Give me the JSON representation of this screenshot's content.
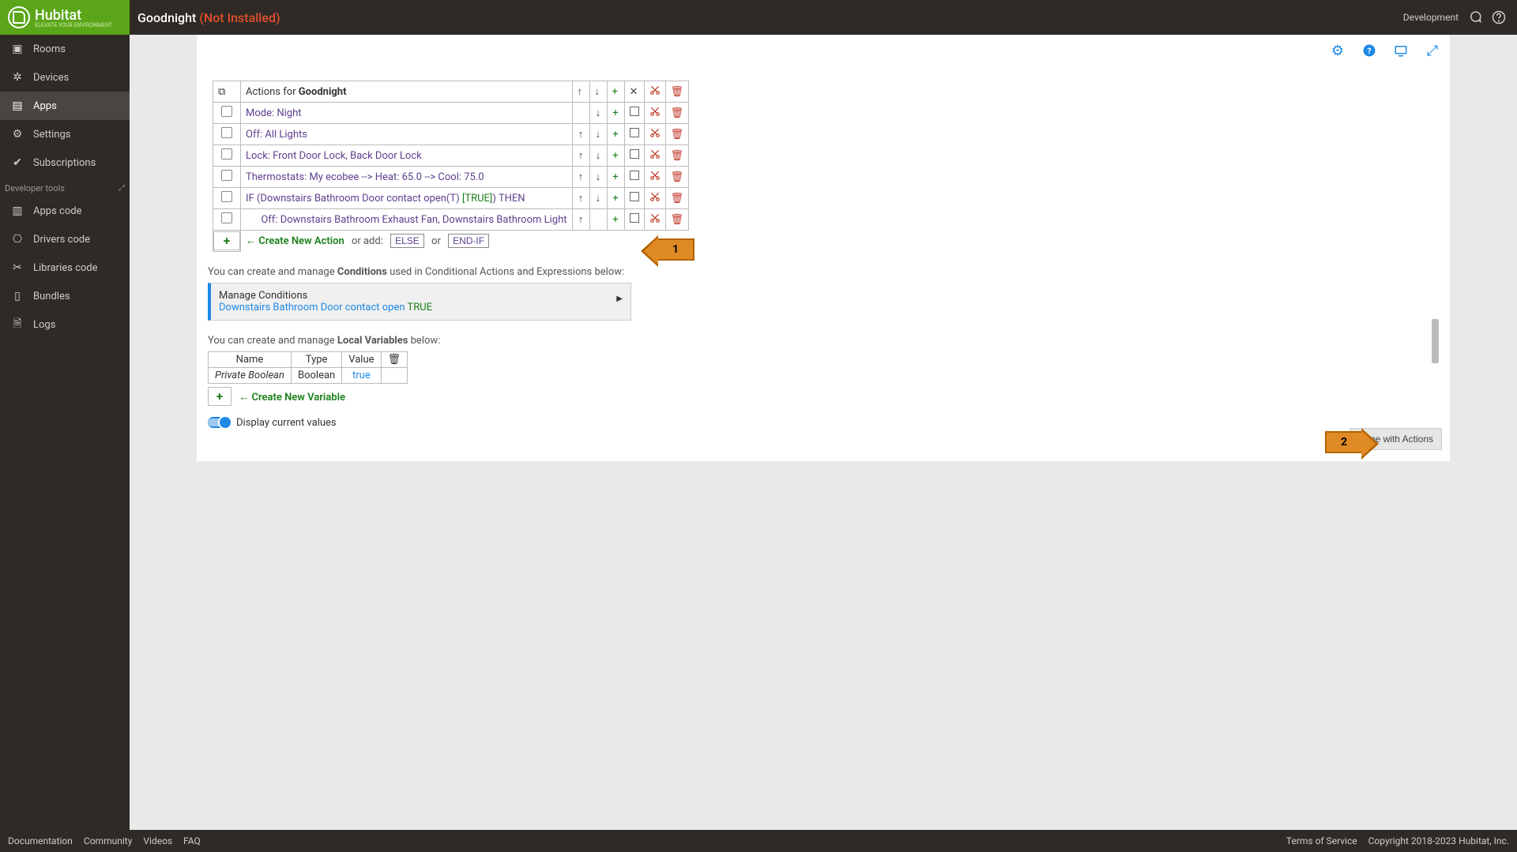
{
  "brand": {
    "name": "Hubitat",
    "tagline": "ELEVATE YOUR ENVIRONMENT"
  },
  "header": {
    "title": "Goodnight",
    "status": "(Not Installed)",
    "env": "Development"
  },
  "sidebar": {
    "main": [
      {
        "label": "Rooms",
        "icon": "▣"
      },
      {
        "label": "Devices",
        "icon": "✲"
      },
      {
        "label": "Apps",
        "icon": "▤"
      },
      {
        "label": "Settings",
        "icon": "⚙"
      },
      {
        "label": "Subscriptions",
        "icon": "✔"
      }
    ],
    "dev_header": "Developer tools",
    "dev": [
      {
        "label": "Apps code",
        "icon": "▥"
      },
      {
        "label": "Drivers code",
        "icon": "⎔"
      },
      {
        "label": "Libraries code",
        "icon": "✂"
      },
      {
        "label": "Bundles",
        "icon": "▯"
      },
      {
        "label": "Logs",
        "icon": "🗎"
      }
    ]
  },
  "actions": {
    "heading_prefix": "Actions for ",
    "heading_name": "Goodnight",
    "rows": [
      {
        "indent": 0,
        "text": "Mode: Night",
        "up": false,
        "down": true
      },
      {
        "indent": 0,
        "text": "Off: All Lights",
        "up": true,
        "down": true
      },
      {
        "indent": 0,
        "text": "Lock: Front Door Lock, Back Door Lock",
        "up": true,
        "down": true
      },
      {
        "indent": 0,
        "text": "Thermostats: My ecobee --> Heat: 65.0 --> Cool: 75.0",
        "up": true,
        "down": true
      },
      {
        "indent": 0,
        "text_pre": "IF (Downstairs Bathroom Door contact open(T) ",
        "text_true": "[TRUE]",
        "text_post": ") THEN",
        "up": true,
        "down": true,
        "is_if": true
      },
      {
        "indent": 1,
        "text": "Off: Downstairs Bathroom Exhaust Fan, Downstairs Bathroom Light",
        "up": true,
        "down": false
      }
    ],
    "create_new": "Create New Action",
    "or_add": "or add:",
    "else_btn": "ELSE",
    "or": "or",
    "endif_btn": "END-IF"
  },
  "conditions": {
    "intro_pre": "You can create and manage ",
    "intro_bold": "Conditions",
    "intro_post": " used in Conditional Actions and Expressions below:",
    "manage": "Manage Conditions",
    "cond_text": "Downstairs Bathroom Door contact open ",
    "cond_val": "TRUE"
  },
  "vars": {
    "intro_pre": "You can create and manage ",
    "intro_bold": "Local Variables",
    "intro_post": " below:",
    "cols": {
      "name": "Name",
      "type": "Type",
      "value": "Value"
    },
    "row": {
      "name": "Private Boolean",
      "type": "Boolean",
      "value": "true"
    },
    "create": "Create New Variable"
  },
  "toggles": {
    "display_values": "Display current values"
  },
  "done_btn": "Done with Actions",
  "annotations": {
    "a1": "1",
    "a2": "2"
  },
  "footer": {
    "links": [
      "Documentation",
      "Community",
      "Videos",
      "FAQ"
    ],
    "tos": "Terms of Service",
    "copy": "Copyright 2018-2023 Hubitat, Inc."
  }
}
